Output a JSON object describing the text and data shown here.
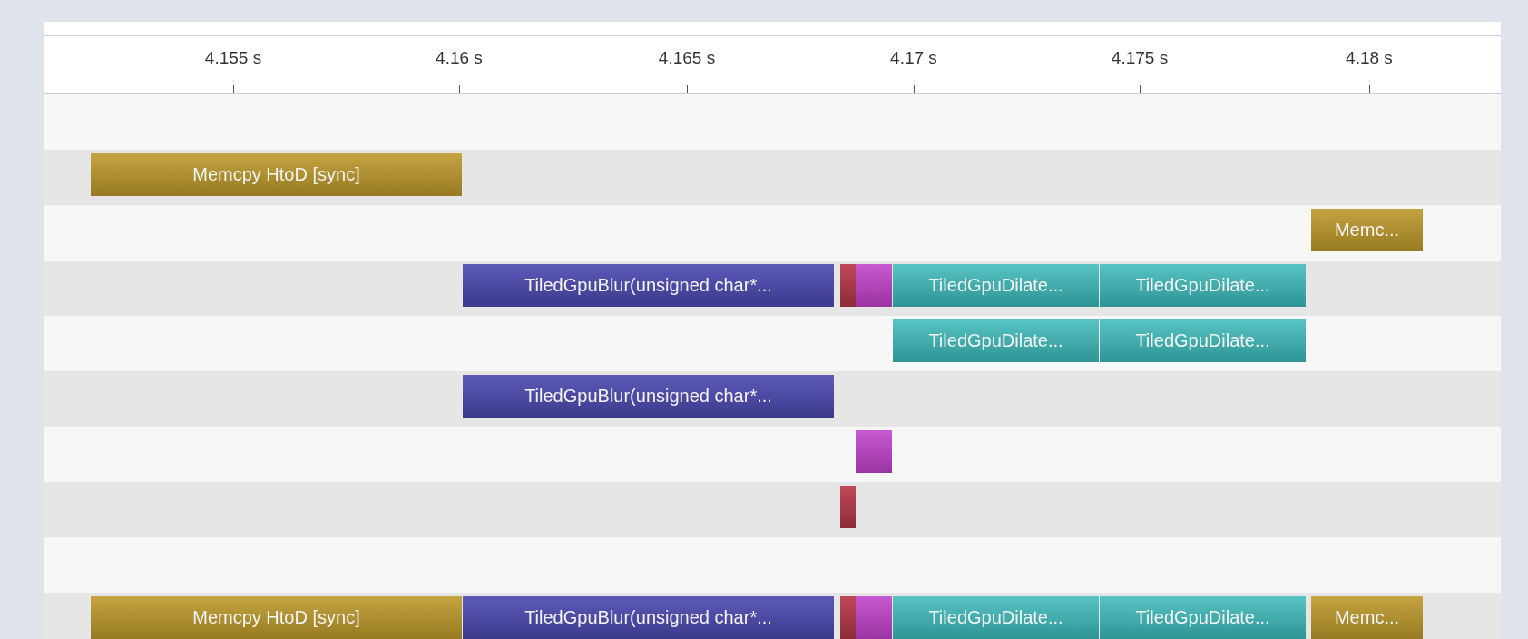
{
  "ruler": {
    "ticks": [
      "4.155 s",
      "4.16 s",
      "4.165 s",
      "4.17 s",
      "4.175 s",
      "4.18 s"
    ]
  },
  "rows": [
    {
      "bars": []
    },
    {
      "bars": [
        {
          "kind": "memcpy",
          "label": "Memcpy HtoD [sync]"
        }
      ]
    },
    {
      "bars": [
        {
          "kind": "memcpy",
          "label": "Memc..."
        }
      ]
    },
    {
      "bars": [
        {
          "kind": "blur",
          "label": "TiledGpuBlur(unsigned char*..."
        },
        {
          "kind": "red"
        },
        {
          "kind": "magenta"
        },
        {
          "kind": "dilate",
          "label": "TiledGpuDilate..."
        },
        {
          "kind": "dilate",
          "label": "TiledGpuDilate..."
        }
      ]
    },
    {
      "bars": [
        {
          "kind": "dilate",
          "label": "TiledGpuDilate..."
        },
        {
          "kind": "dilate",
          "label": "TiledGpuDilate..."
        }
      ]
    },
    {
      "bars": [
        {
          "kind": "blur",
          "label": "TiledGpuBlur(unsigned char*..."
        }
      ]
    },
    {
      "bars": [
        {
          "kind": "magenta"
        }
      ]
    },
    {
      "bars": [
        {
          "kind": "red"
        }
      ]
    },
    {
      "bars": []
    },
    {
      "bars": [
        {
          "kind": "memcpy",
          "label": "Memcpy HtoD [sync]"
        },
        {
          "kind": "blur",
          "label": "TiledGpuBlur(unsigned char*..."
        },
        {
          "kind": "red"
        },
        {
          "kind": "magenta"
        },
        {
          "kind": "dilate",
          "label": "TiledGpuDilate..."
        },
        {
          "kind": "dilate",
          "label": "TiledGpuDilate..."
        },
        {
          "kind": "memcpy",
          "label": "Memc..."
        }
      ]
    }
  ]
}
